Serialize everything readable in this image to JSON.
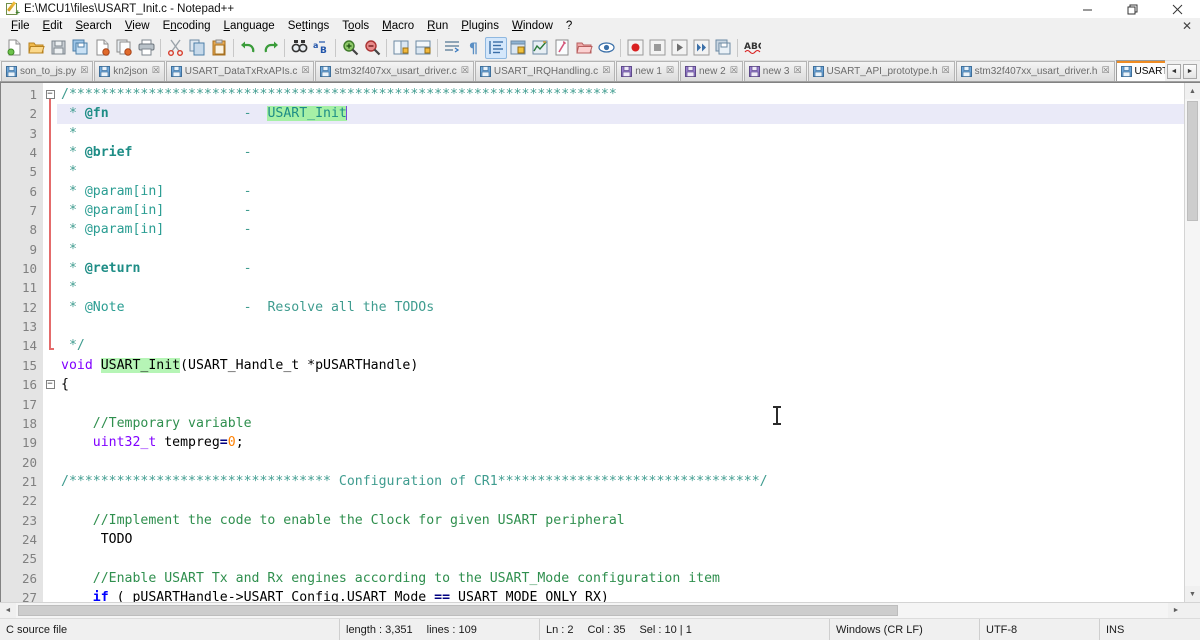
{
  "window": {
    "title": "E:\\MCU1\\files\\USART_Init.c - Notepad++",
    "icon": "notepad-plus-plus-icon",
    "minimize": "—",
    "maximize": "❐",
    "close": "✕",
    "doc_close": "✕"
  },
  "menu": [
    {
      "label": "File",
      "pre": "F",
      "rest": "ile"
    },
    {
      "label": "Edit",
      "pre": "E",
      "rest": "dit"
    },
    {
      "label": "Search",
      "pre": "S",
      "rest": "earch"
    },
    {
      "label": "View",
      "pre": "V",
      "rest": "iew"
    },
    {
      "label": "Encoding",
      "pre": "E",
      "rest": "ncoding"
    },
    {
      "label": "Language",
      "pre": "L",
      "rest": "anguage"
    },
    {
      "label": "Settings",
      "pre": "S",
      "rest": "ettings"
    },
    {
      "label": "Tools",
      "pre": "T",
      "rest": "ools"
    },
    {
      "label": "Macro",
      "pre": "M",
      "rest": "acro"
    },
    {
      "label": "Run",
      "pre": "R",
      "rest": "un"
    },
    {
      "label": "Plugins",
      "pre": "P",
      "rest": "lugins"
    },
    {
      "label": "Window",
      "pre": "W",
      "rest": "indow"
    },
    {
      "label": "?",
      "pre": "?",
      "rest": ""
    }
  ],
  "toolbar": [
    {
      "name": "new-file-icon",
      "title": "New"
    },
    {
      "name": "open-file-icon",
      "title": "Open"
    },
    {
      "name": "save-icon",
      "title": "Save"
    },
    {
      "name": "save-all-icon",
      "title": "Save All"
    },
    {
      "name": "close-file-icon",
      "title": "Close"
    },
    {
      "name": "close-all-files-icon",
      "title": "Close All"
    },
    {
      "name": "print-icon",
      "title": "Print"
    },
    {
      "name": "separator",
      "title": ""
    },
    {
      "name": "cut-icon",
      "title": "Cut"
    },
    {
      "name": "copy-icon",
      "title": "Copy"
    },
    {
      "name": "paste-icon",
      "title": "Paste"
    },
    {
      "name": "separator",
      "title": ""
    },
    {
      "name": "undo-icon",
      "title": "Undo"
    },
    {
      "name": "redo-icon",
      "title": "Redo"
    },
    {
      "name": "separator",
      "title": ""
    },
    {
      "name": "find-icon",
      "title": "Find"
    },
    {
      "name": "replace-icon",
      "title": "Replace"
    },
    {
      "name": "separator",
      "title": ""
    },
    {
      "name": "zoom-in-icon",
      "title": "Zoom In"
    },
    {
      "name": "zoom-out-icon",
      "title": "Zoom Out"
    },
    {
      "name": "separator",
      "title": ""
    },
    {
      "name": "sync-vertical-scroll-icon",
      "title": "Synchronize Vertical Scrolling"
    },
    {
      "name": "sync-horizontal-scroll-icon",
      "title": "Synchronize Horizontal Scrolling"
    },
    {
      "name": "separator",
      "title": ""
    },
    {
      "name": "word-wrap-icon",
      "title": "Word wrap"
    },
    {
      "name": "show-all-characters-icon",
      "title": "Show All Characters"
    },
    {
      "name": "indent-guide-icon",
      "title": "Show Indent Guide",
      "active": true
    },
    {
      "name": "user-defined-dialog-icon",
      "title": "User-Defined Dialogue"
    },
    {
      "name": "document-map-icon",
      "title": "Document Map"
    },
    {
      "name": "function-list-icon",
      "title": "Function List"
    },
    {
      "name": "folder-as-workspace-icon",
      "title": "Folder as Workspace"
    },
    {
      "name": "monitoring-icon",
      "title": "Monitoring"
    },
    {
      "name": "separator",
      "title": ""
    },
    {
      "name": "record-macro-icon",
      "title": "Start Recording"
    },
    {
      "name": "stop-macro-icon",
      "title": "Stop Recording"
    },
    {
      "name": "play-macro-icon",
      "title": "Playback"
    },
    {
      "name": "run-macro-multiple-icon",
      "title": "Run a Macro Multiple Times"
    },
    {
      "name": "save-macro-icon",
      "title": "Save Current Recorded Macro"
    },
    {
      "name": "separator",
      "title": ""
    },
    {
      "name": "spell-check-icon",
      "title": "Spell Checker"
    }
  ],
  "tabs": [
    {
      "label": "son_to_js.py",
      "icon": "saved-file-icon",
      "active": false
    },
    {
      "label": "kn2json",
      "icon": "saved-file-icon",
      "active": false
    },
    {
      "label": "USART_DataTxRxAPIs.c",
      "icon": "saved-file-icon",
      "active": false
    },
    {
      "label": "stm32f407xx_usart_driver.c",
      "icon": "saved-file-icon",
      "active": false
    },
    {
      "label": "USART_IRQHandling.c",
      "icon": "saved-file-icon",
      "active": false
    },
    {
      "label": "new 1",
      "icon": "unsaved-file-icon",
      "active": false
    },
    {
      "label": "new 2",
      "icon": "unsaved-file-icon",
      "active": false
    },
    {
      "label": "new 3",
      "icon": "unsaved-file-icon",
      "active": false
    },
    {
      "label": "USART_API_prototype.h",
      "icon": "saved-file-icon",
      "active": false
    },
    {
      "label": "stm32f407xx_usart_driver.h",
      "icon": "saved-file-icon",
      "active": false
    },
    {
      "label": "USART_Init.c",
      "icon": "saved-file-icon",
      "active": true
    }
  ],
  "tab_nav": {
    "prev": "◄",
    "next": "►"
  },
  "editor": {
    "first_line": 1,
    "lines": [
      {
        "n": 1,
        "fold": "open",
        "tokens": [
          {
            "t": "/",
            "c": "c-comment"
          },
          {
            "t": "*********************************************************************",
            "c": "c-comment"
          }
        ]
      },
      {
        "n": 2,
        "current": true,
        "tokens": [
          {
            "t": " * ",
            "c": "c-comment"
          },
          {
            "t": "@fn",
            "c": "c-doc"
          },
          {
            "t": "                 -  ",
            "c": "c-comment"
          },
          {
            "t": "USART_Init",
            "c": "sel-green"
          },
          {
            "t": "|caret|",
            "c": "caret"
          }
        ]
      },
      {
        "n": 3,
        "tokens": [
          {
            "t": " *",
            "c": "c-comment"
          }
        ]
      },
      {
        "n": 4,
        "tokens": [
          {
            "t": " * ",
            "c": "c-comment"
          },
          {
            "t": "@brief",
            "c": "c-doc"
          },
          {
            "t": "              -",
            "c": "c-comment"
          }
        ]
      },
      {
        "n": 5,
        "tokens": [
          {
            "t": " *",
            "c": "c-comment"
          }
        ]
      },
      {
        "n": 6,
        "tokens": [
          {
            "t": " * ",
            "c": "c-comment"
          },
          {
            "t": "@param[in]",
            "c": "c-docp"
          },
          {
            "t": "          -",
            "c": "c-comment"
          }
        ]
      },
      {
        "n": 7,
        "tokens": [
          {
            "t": " * ",
            "c": "c-comment"
          },
          {
            "t": "@param[in]",
            "c": "c-docp"
          },
          {
            "t": "          -",
            "c": "c-comment"
          }
        ]
      },
      {
        "n": 8,
        "tokens": [
          {
            "t": " * ",
            "c": "c-comment"
          },
          {
            "t": "@param[in]",
            "c": "c-docp"
          },
          {
            "t": "          -",
            "c": "c-comment"
          }
        ]
      },
      {
        "n": 9,
        "tokens": [
          {
            "t": " *",
            "c": "c-comment"
          }
        ]
      },
      {
        "n": 10,
        "tokens": [
          {
            "t": " * ",
            "c": "c-comment"
          },
          {
            "t": "@return",
            "c": "c-doc"
          },
          {
            "t": "             -",
            "c": "c-comment"
          }
        ]
      },
      {
        "n": 11,
        "tokens": [
          {
            "t": " *",
            "c": "c-comment"
          }
        ]
      },
      {
        "n": 12,
        "tokens": [
          {
            "t": " * ",
            "c": "c-comment"
          },
          {
            "t": "@Note",
            "c": "c-docp"
          },
          {
            "t": "               -  Resolve all the TODOs",
            "c": "c-comment"
          }
        ]
      },
      {
        "n": 13,
        "tokens": []
      },
      {
        "n": 14,
        "fold": "close",
        "tokens": [
          {
            "t": " */",
            "c": "c-comment"
          }
        ]
      },
      {
        "n": 15,
        "tokens": [
          {
            "t": "void ",
            "c": "c-kw"
          },
          {
            "t": "USART_Init",
            "c": "sel-green2"
          },
          {
            "t": "(USART_Handle_t *pUSARTHandle)",
            "c": "c-plain"
          }
        ]
      },
      {
        "n": 16,
        "fold": "open",
        "tokens": [
          {
            "t": "{",
            "c": "c-plain"
          }
        ]
      },
      {
        "n": 17,
        "tokens": []
      },
      {
        "n": 18,
        "tokens": [
          {
            "t": "    //Temporary variable",
            "c": "c-comment2"
          }
        ]
      },
      {
        "n": 19,
        "tokens": [
          {
            "t": "    uint32_t ",
            "c": "c-kw"
          },
          {
            "t": "tempreg",
            "c": "c-plain"
          },
          {
            "t": "=",
            "c": "c-op"
          },
          {
            "t": "0",
            "c": "c-num"
          },
          {
            "t": ";",
            "c": "c-plain"
          }
        ]
      },
      {
        "n": 20,
        "tokens": []
      },
      {
        "n": 21,
        "tokens": [
          {
            "t": "/********************************* Configuration of CR1*********************************/",
            "c": "c-comment"
          }
        ]
      },
      {
        "n": 22,
        "tokens": []
      },
      {
        "n": 23,
        "tokens": [
          {
            "t": "    //Implement the code to enable the Clock for given USART peripheral",
            "c": "c-comment2"
          }
        ]
      },
      {
        "n": 24,
        "tokens": [
          {
            "t": "     TODO",
            "c": "c-plain"
          }
        ]
      },
      {
        "n": 25,
        "tokens": []
      },
      {
        "n": 26,
        "tokens": [
          {
            "t": "    //Enable USART Tx and Rx engines according to the USART_Mode configuration item",
            "c": "c-comment2"
          }
        ]
      },
      {
        "n": 27,
        "tokens": [
          {
            "t": "    if",
            "c": "c-kw2"
          },
          {
            "t": " ( pUSARTHandle->USART_Config.USART_Mode ",
            "c": "c-plain"
          },
          {
            "t": "==",
            "c": "c-op"
          },
          {
            "t": " USART_MODE_ONLY_RX)",
            "c": "c-plain"
          }
        ]
      }
    ]
  },
  "scroll": {
    "up": "▲",
    "down": "▼",
    "left": "◄",
    "right": "►"
  },
  "status": {
    "file_type": "C source file",
    "length_label": "length : 3,351",
    "lines_label": "lines : 109",
    "ln": "Ln : 2",
    "col": "Col : 35",
    "sel": "Sel : 10 | 1",
    "eol": "Windows (CR LF)",
    "encoding": "UTF-8",
    "mode": "INS"
  }
}
